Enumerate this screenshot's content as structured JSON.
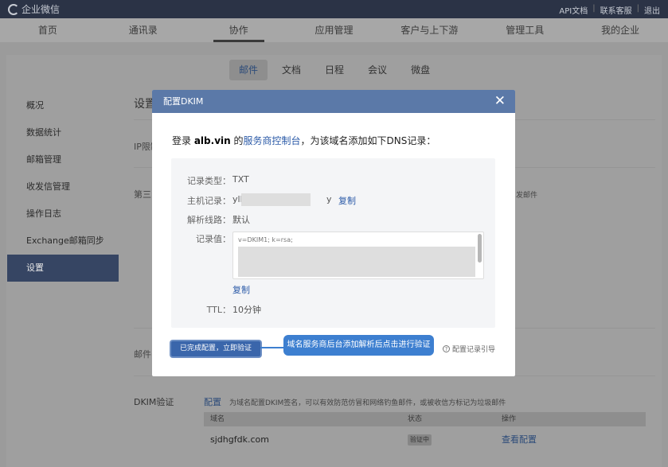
{
  "topbar": {
    "logo": "企业微信",
    "links": [
      "API文档",
      "联系客服",
      "退出"
    ]
  },
  "nav": [
    "首页",
    "通讯录",
    "协作",
    "应用管理",
    "客户与上下游",
    "管理工具",
    "我的企业"
  ],
  "subtabs": [
    "邮件",
    "文档",
    "日程",
    "会议",
    "微盘"
  ],
  "sidebar": [
    "概况",
    "数据统计",
    "邮箱管理",
    "收发信管理",
    "操作日志",
    "Exchange邮箱同步",
    "设置"
  ],
  "content": {
    "title": "设置",
    "ip_label": "IP限制",
    "third_label": "第三",
    "right_note": "发邮件",
    "mail_label": "邮件",
    "dkim": {
      "label": "DKIM验证",
      "link": "配置",
      "desc": "为域名配置DKIM签名，可以有效防范仿冒和网络钓鱼邮件，或被收信方标记为垃圾邮件",
      "headers": [
        "域名",
        "状态",
        "操作"
      ],
      "rows": [
        {
          "domain": "sjdhgfdk.com",
          "status": "验证中",
          "action": "查看配置"
        }
      ]
    }
  },
  "modal": {
    "title": "配置DKIM",
    "close": "✕",
    "intro_prefix": "登录 ",
    "intro_domain": "alb.vin",
    "intro_mid": " 的",
    "intro_link": "服务商控制台",
    "intro_suffix": "，为该域名添加如下DNS记录：",
    "record": {
      "type_label": "记录类型：",
      "type_value": "TXT",
      "host_label": "主机记录：",
      "host_prefix": "yll",
      "host_suffix": "y",
      "copy": "复制",
      "line_label": "解析线路：",
      "line_value": "默认",
      "value_label": "记录值：",
      "value_text": "v=DKIM1; k=rsa;",
      "value_copy": "复制",
      "ttl_label": "TTL：",
      "ttl_value": "10分钟"
    },
    "verify_button": "已完成配置，立即验证",
    "callout": "域名服务商后台添加解析后点击进行验证",
    "guide": "配置记录引导",
    "guide_icon": "?"
  }
}
